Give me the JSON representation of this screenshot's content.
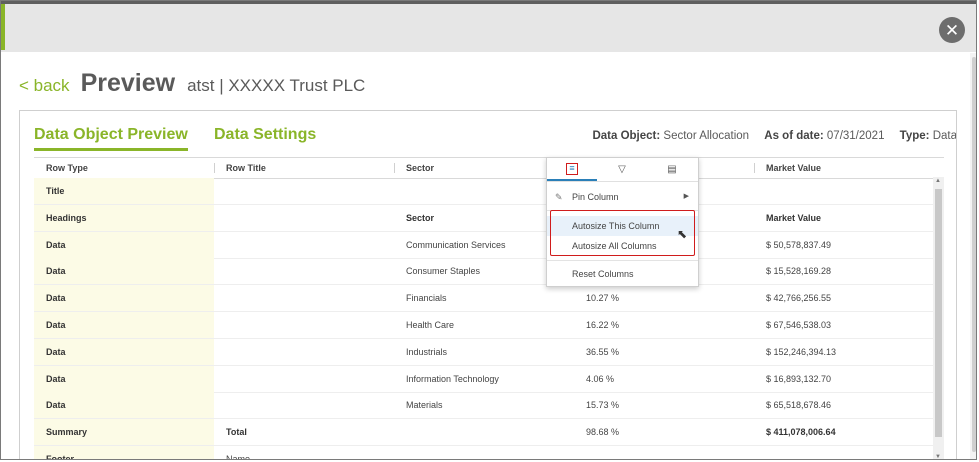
{
  "window": {
    "close_icon": "close-icon"
  },
  "header": {
    "back_label": "< back",
    "title": "Preview",
    "subtitle": "atst |  XXXXX  Trust PLC"
  },
  "tabs": [
    {
      "label": "Data Object Preview",
      "active": true
    },
    {
      "label": "Data Settings",
      "active": false
    }
  ],
  "meta": {
    "data_object_label": "Data Object:",
    "data_object_value": "Sector Allocation",
    "as_of_label": "As of date:",
    "as_of_value": "07/31/2021",
    "type_label": "Type:",
    "type_value": "Data"
  },
  "grid": {
    "columns": [
      "Row Type",
      "Row Title",
      "Sector",
      "",
      "Market Value"
    ],
    "rows": [
      {
        "type": "Title",
        "title": "",
        "sector": "",
        "weight": "",
        "value": "",
        "bold": false
      },
      {
        "type": "Headings",
        "title": "",
        "sector": "Sector",
        "weight": "",
        "value": "Market Value",
        "bold": true
      },
      {
        "type": "Data",
        "title": "",
        "sector": "Communication Services",
        "weight": "",
        "value": "$ 50,578,837.49",
        "bold": false
      },
      {
        "type": "Data",
        "title": "",
        "sector": "Consumer Staples",
        "weight": "",
        "value": "$ 15,528,169.28",
        "bold": false
      },
      {
        "type": "Data",
        "title": "",
        "sector": "Financials",
        "weight": "10.27 %",
        "value": "$ 42,766,256.55",
        "bold": false
      },
      {
        "type": "Data",
        "title": "",
        "sector": "Health Care",
        "weight": "16.22 %",
        "value": "$ 67,546,538.03",
        "bold": false
      },
      {
        "type": "Data",
        "title": "",
        "sector": "Industrials",
        "weight": "36.55 %",
        "value": "$ 152,246,394.13",
        "bold": false
      },
      {
        "type": "Data",
        "title": "",
        "sector": "Information Technology",
        "weight": "4.06 %",
        "value": "$ 16,893,132.70",
        "bold": false
      },
      {
        "type": "Data",
        "title": "",
        "sector": "Materials",
        "weight": "15.73 %",
        "value": "$ 65,518,678.46",
        "bold": false
      },
      {
        "type": "Summary",
        "title": "Total",
        "sector": "",
        "weight": "98.68 %",
        "value": "$ 411,078,006.64",
        "bold": true
      },
      {
        "type": "Footer",
        "title": "Name",
        "sector": "",
        "weight": "",
        "value": "",
        "bold": false
      }
    ]
  },
  "column_menu": {
    "tab_icons": [
      "menu-icon",
      "filter-icon",
      "columns-icon"
    ],
    "items": [
      "Pin Column",
      "Autosize This Column",
      "Autosize All Columns",
      "Reset Columns"
    ],
    "highlight_color": "#d01c1c"
  },
  "colors": {
    "accent": "#8ab529",
    "text": "#5a5a5a",
    "row_type_bg": "#fcfbe6"
  }
}
